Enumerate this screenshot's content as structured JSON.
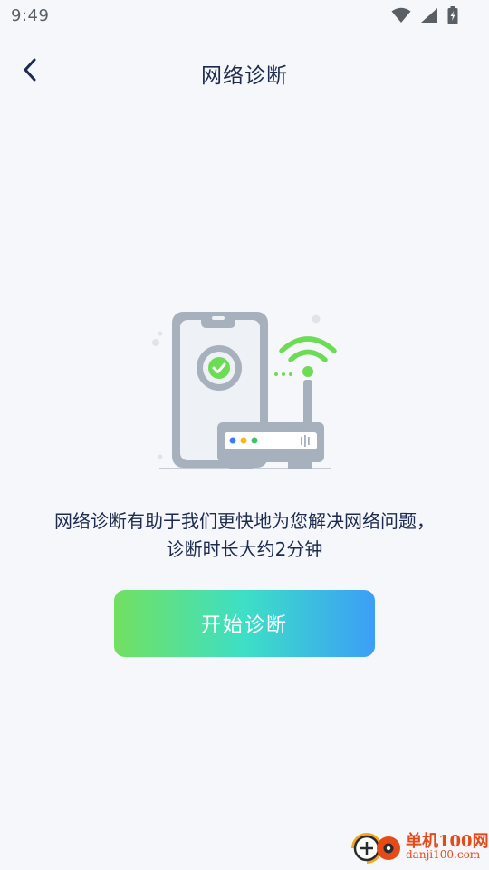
{
  "status_bar": {
    "time": "9:49",
    "icons": [
      "wifi-icon",
      "cellular-signal-icon",
      "battery-charging-icon"
    ]
  },
  "header": {
    "back_icon": "chevron-left-icon",
    "title": "网络诊断"
  },
  "illustration": {
    "icons": [
      "phone-icon",
      "check-circle-icon",
      "wifi-signal-icon",
      "router-icon"
    ],
    "colors": {
      "device_gray": "#a7b0bd",
      "device_light": "#eef1f5",
      "wifi_green": "#6cdc55",
      "dot_blue": "#3b7bf6",
      "dot_yellow": "#f5b623",
      "dot_green": "#3cc46b"
    }
  },
  "description": {
    "line1": "网络诊断有助于我们更快地为您解决网络问题，",
    "line2": "诊断时长大约2分钟"
  },
  "actions": {
    "start_label": "开始诊断"
  },
  "watermark": {
    "brand": "单机100网",
    "domain": "danji100.com"
  },
  "theme": {
    "background": "#f5f7fb",
    "text_primary": "#1d2b4f",
    "button_gradient": [
      "#72e060",
      "#3ddfc6",
      "#3c9ef7"
    ]
  }
}
